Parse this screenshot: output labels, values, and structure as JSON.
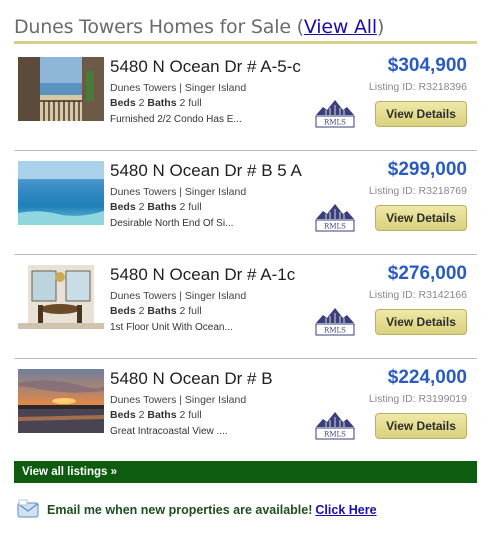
{
  "header": {
    "title": "Dunes Towers Homes for Sale",
    "open_paren": "(",
    "view_all_link": "View All",
    "close_paren": ")"
  },
  "listings": [
    {
      "address": "5480 N Ocean Dr # A-5-c",
      "subdivision": "Dunes Towers | Singer Island",
      "beds_label": "Beds",
      "beds": "2",
      "baths_label": "Baths",
      "baths": "2 full",
      "description": "Furnished 2/2 Condo Has E...",
      "price": "$304,900",
      "listing_id": "Listing ID: R3218396",
      "button": "View Details",
      "photo_icon": "balcony-ocean-photo"
    },
    {
      "address": "5480 N Ocean Dr # B 5 A",
      "subdivision": "Dunes Towers | Singer Island",
      "beds_label": "Beds",
      "beds": "2",
      "baths_label": "Baths",
      "baths": "2 full",
      "description": "Desirable North End Of Si...",
      "price": "$299,000",
      "listing_id": "Listing ID: R3218769",
      "button": "View Details",
      "photo_icon": "ocean-view-photo"
    },
    {
      "address": "5480 N Ocean Dr # A-1c",
      "subdivision": "Dunes Towers | Singer Island",
      "beds_label": "Beds",
      "beds": "2",
      "baths_label": "Baths",
      "baths": "2 full",
      "description": "1st Floor Unit With Ocean...",
      "price": "$276,000",
      "listing_id": "Listing ID: R3142166",
      "button": "View Details",
      "photo_icon": "dining-room-photo"
    },
    {
      "address": "5480 N Ocean Dr # B",
      "subdivision": "Dunes Towers | Singer Island",
      "beds_label": "Beds",
      "beds": "2",
      "baths_label": "Baths",
      "baths": "2 full",
      "description": "Great Intracoastal View ....",
      "price": "$224,000",
      "listing_id": "Listing ID: R3199019",
      "button": "View Details",
      "photo_icon": "sunset-photo"
    }
  ],
  "rmls_logo": "RMLS",
  "footer": {
    "view_all_listings": "View all listings »",
    "email_text": "Email me when new properties are available!",
    "email_link": "Click Here"
  },
  "colors": {
    "price": "#2a5bc2",
    "footer_bar": "#0e5c10",
    "button": "#e4dc8f",
    "header_rule": "#d4d08a"
  }
}
